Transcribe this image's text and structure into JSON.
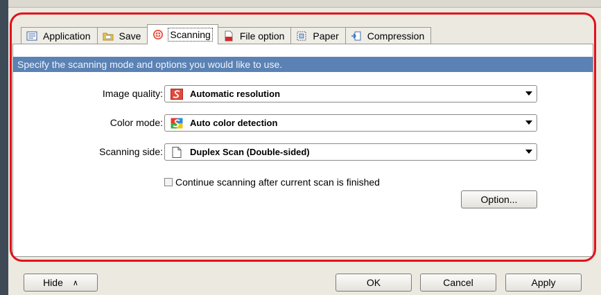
{
  "tabs": [
    {
      "label": "Application",
      "icon": "application-icon",
      "active": false
    },
    {
      "label": "Save",
      "icon": "folder-icon",
      "active": false
    },
    {
      "label": "Scanning",
      "icon": "scanning-icon",
      "active": true
    },
    {
      "label": "File option",
      "icon": "file-option-icon",
      "active": false
    },
    {
      "label": "Paper",
      "icon": "paper-icon",
      "active": false
    },
    {
      "label": "Compression",
      "icon": "compression-icon",
      "active": false
    }
  ],
  "panel": {
    "description": "Specify the scanning mode and options you would like to use.",
    "image_quality": {
      "label": "Image quality:",
      "value": "Automatic resolution",
      "icon": "resolution-icon"
    },
    "color_mode": {
      "label": "Color mode:",
      "value": "Auto color detection",
      "icon": "color-detection-icon"
    },
    "scanning_side": {
      "label": "Scanning side:",
      "value": "Duplex Scan (Double-sided)",
      "icon": "page-icon"
    },
    "continue_checkbox": {
      "label": "Continue scanning after current scan is finished",
      "checked": false
    },
    "option_button": "Option..."
  },
  "footer": {
    "hide_label": "Hide",
    "ok_label": "OK",
    "cancel_label": "Cancel",
    "apply_label": "Apply"
  },
  "colors": {
    "highlight": "#e3101a",
    "description_bar": "#5b82b4"
  }
}
